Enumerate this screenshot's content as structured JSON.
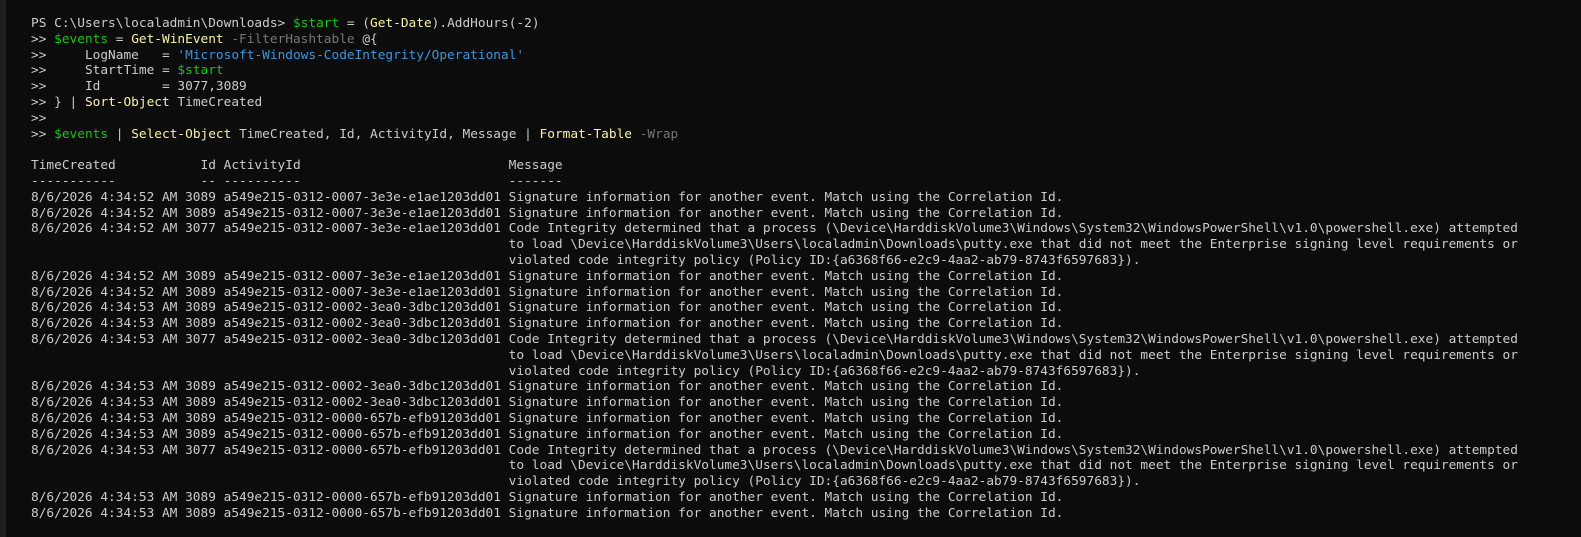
{
  "prompt": {
    "line1": "PS C:\\Users\\localadmin\\Downloads> ",
    "cont": ">> "
  },
  "command": {
    "l1_var": "$start",
    "l1_eq": " = (",
    "l1_cmd": "Get-Date",
    "l1_rest": ").AddHours(-2)",
    "l2_var": "$events",
    "l2_eq": " = ",
    "l2_cmd": "Get-WinEvent",
    "l2_param": " -FilterHashtable",
    "l2_rest": " @{",
    "l3_key": "    LogName   = ",
    "l3_str": "'Microsoft-Windows-CodeIntegrity/Operational'",
    "l4_key": "    StartTime = ",
    "l4_var": "$start",
    "l5_key": "    Id        = ",
    "l5_val": "3077,3089",
    "l6_a": "} | ",
    "l6_cmd": "Sort-Object",
    "l6_rest": " TimeCreated",
    "l8_var": "$events",
    "l8_a": " | ",
    "l8_cmd1": "Select-Object",
    "l8_b": " TimeCreated, Id, ActivityId, Message | ",
    "l8_cmd2": "Format-Table",
    "l8_param": " -Wrap"
  },
  "table": {
    "header": "TimeCreated           Id ActivityId                           Message",
    "underline": "-----------           -- ----------                           -------",
    "rows": [
      "8/6/2026 4:34:52 AM 3089 a549e215-0312-0007-3e3e-e1ae1203dd01 Signature information for another event. Match using the Correlation Id.",
      "8/6/2026 4:34:52 AM 3089 a549e215-0312-0007-3e3e-e1ae1203dd01 Signature information for another event. Match using the Correlation Id.",
      "8/6/2026 4:34:52 AM 3077 a549e215-0312-0007-3e3e-e1ae1203dd01 Code Integrity determined that a process (\\Device\\HarddiskVolume3\\Windows\\System32\\WindowsPowerShell\\v1.0\\powershell.exe) attempted",
      "                                                              to load \\Device\\HarddiskVolume3\\Users\\localadmin\\Downloads\\putty.exe that did not meet the Enterprise signing level requirements or",
      "                                                              violated code integrity policy (Policy ID:{a6368f66-e2c9-4aa2-ab79-8743f6597683}).",
      "8/6/2026 4:34:52 AM 3089 a549e215-0312-0007-3e3e-e1ae1203dd01 Signature information for another event. Match using the Correlation Id.",
      "8/6/2026 4:34:52 AM 3089 a549e215-0312-0007-3e3e-e1ae1203dd01 Signature information for another event. Match using the Correlation Id.",
      "8/6/2026 4:34:53 AM 3089 a549e215-0312-0002-3ea0-3dbc1203dd01 Signature information for another event. Match using the Correlation Id.",
      "8/6/2026 4:34:53 AM 3089 a549e215-0312-0002-3ea0-3dbc1203dd01 Signature information for another event. Match using the Correlation Id.",
      "8/6/2026 4:34:53 AM 3077 a549e215-0312-0002-3ea0-3dbc1203dd01 Code Integrity determined that a process (\\Device\\HarddiskVolume3\\Windows\\System32\\WindowsPowerShell\\v1.0\\powershell.exe) attempted",
      "                                                              to load \\Device\\HarddiskVolume3\\Users\\localadmin\\Downloads\\putty.exe that did not meet the Enterprise signing level requirements or",
      "                                                              violated code integrity policy (Policy ID:{a6368f66-e2c9-4aa2-ab79-8743f6597683}).",
      "8/6/2026 4:34:53 AM 3089 a549e215-0312-0002-3ea0-3dbc1203dd01 Signature information for another event. Match using the Correlation Id.",
      "8/6/2026 4:34:53 AM 3089 a549e215-0312-0002-3ea0-3dbc1203dd01 Signature information for another event. Match using the Correlation Id.",
      "8/6/2026 4:34:53 AM 3089 a549e215-0312-0000-657b-efb91203dd01 Signature information for another event. Match using the Correlation Id.",
      "8/6/2026 4:34:53 AM 3089 a549e215-0312-0000-657b-efb91203dd01 Signature information for another event. Match using the Correlation Id.",
      "8/6/2026 4:34:53 AM 3077 a549e215-0312-0000-657b-efb91203dd01 Code Integrity determined that a process (\\Device\\HarddiskVolume3\\Windows\\System32\\WindowsPowerShell\\v1.0\\powershell.exe) attempted",
      "                                                              to load \\Device\\HarddiskVolume3\\Users\\localadmin\\Downloads\\putty.exe that did not meet the Enterprise signing level requirements or",
      "                                                              violated code integrity policy (Policy ID:{a6368f66-e2c9-4aa2-ab79-8743f6597683}).",
      "8/6/2026 4:34:53 AM 3089 a549e215-0312-0000-657b-efb91203dd01 Signature information for another event. Match using the Correlation Id.",
      "8/6/2026 4:34:53 AM 3089 a549e215-0312-0000-657b-efb91203dd01 Signature information for another event. Match using the Correlation Id."
    ]
  },
  "colors": {
    "background": "#0c0c0c",
    "text": "#cccccc",
    "string": "#3a96dd",
    "variable": "#16c60c",
    "cmdlet": "#f9f1a5",
    "parameter": "#767676"
  }
}
